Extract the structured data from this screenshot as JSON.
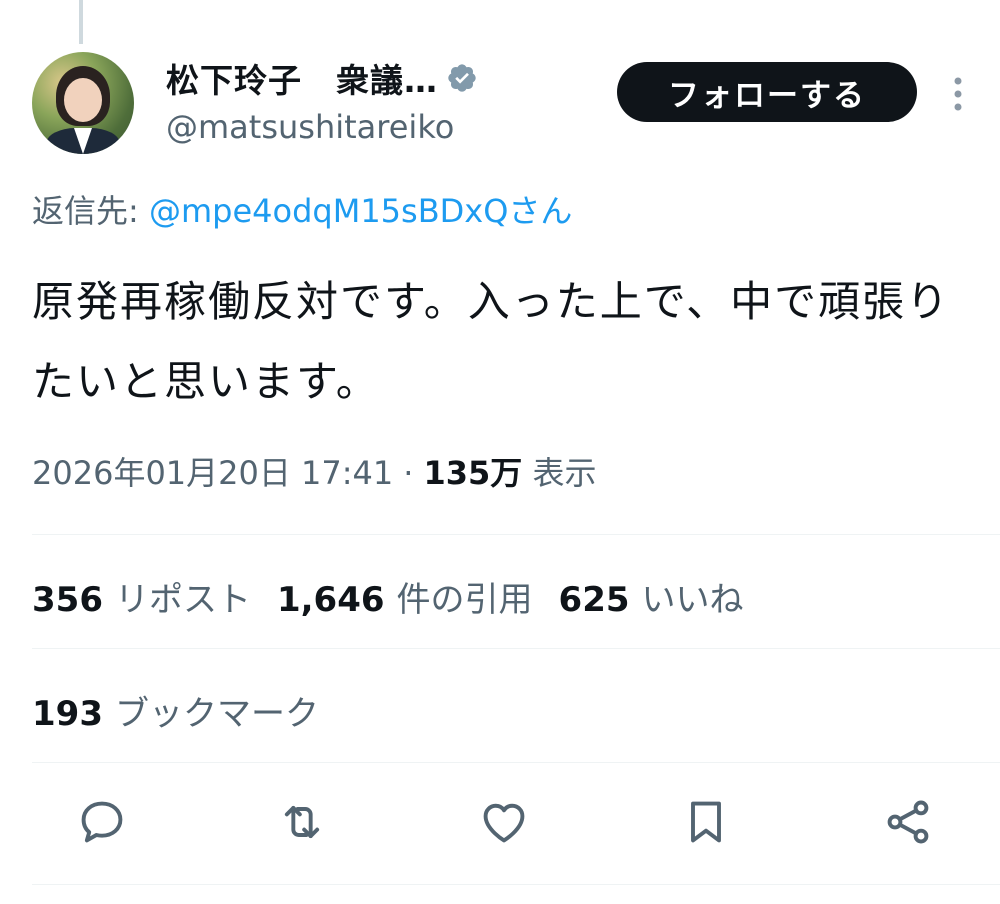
{
  "author": {
    "display_name": "松下玲子　衆議…",
    "handle": "@matsushitareiko",
    "verified_icon": "verified-badge-icon",
    "avatar": "profile-photo"
  },
  "header": {
    "follow_label": "フォローする",
    "more_icon": "more-vertical-icon"
  },
  "reply": {
    "prefix": "返信先:",
    "mention": "@mpe4odqM15sBDxQさん"
  },
  "tweet": {
    "text": "原発再稼働反対です。入った上で、中で頑張りたいと思います。"
  },
  "meta": {
    "datetime": "2026年01月20日 17:41",
    "separator": "·",
    "views_count": "135万",
    "views_label": "表示"
  },
  "stats": {
    "reposts_count": "356",
    "reposts_label": "リポスト",
    "quotes_count": "1,646",
    "quotes_label": "件の引用",
    "likes_count": "625",
    "likes_label": "いいね",
    "bookmarks_count": "193",
    "bookmarks_label": "ブックマーク"
  },
  "actions": [
    "reply-icon",
    "repost-icon",
    "like-icon",
    "bookmark-icon",
    "share-icon"
  ],
  "colors": {
    "text_primary": "#0f1419",
    "text_secondary": "#536471",
    "link": "#1d9bf0",
    "button_bg": "#0f1419",
    "divider": "#eff3f4"
  }
}
